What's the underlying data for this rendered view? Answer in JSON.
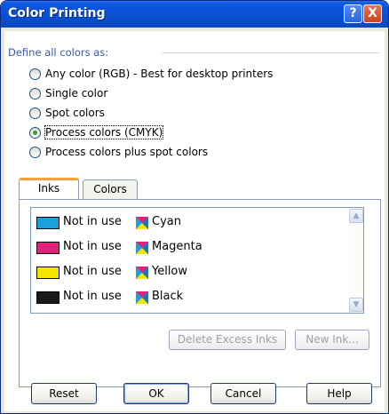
{
  "window": {
    "title": "Color Printing",
    "help_glyph": "?",
    "close_glyph": "X"
  },
  "group": {
    "label": "Define all colors as:"
  },
  "radios": [
    {
      "label": "Any color (RGB) - Best for desktop printers",
      "checked": false
    },
    {
      "label": "Single color",
      "checked": false
    },
    {
      "label": "Spot colors",
      "checked": false
    },
    {
      "label": "Process colors (CMYK)",
      "checked": true
    },
    {
      "label": "Process colors plus spot colors",
      "checked": false
    }
  ],
  "tabs": [
    {
      "label": "Inks",
      "active": true
    },
    {
      "label": "Colors",
      "active": false
    }
  ],
  "inks": [
    {
      "status": "Not in use",
      "name": "Cyan",
      "color": "#1aa0db"
    },
    {
      "status": "Not in use",
      "name": "Magenta",
      "color": "#e0237a"
    },
    {
      "status": "Not in use",
      "name": "Yellow",
      "color": "#f5e600"
    },
    {
      "status": "Not in use",
      "name": "Black",
      "color": "#1a1a1a"
    }
  ],
  "panel_buttons": {
    "delete_excess": "Delete Excess Inks",
    "new_ink": "New Ink..."
  },
  "buttons": {
    "reset": "Reset",
    "ok": "OK",
    "cancel": "Cancel",
    "help": "Help"
  }
}
